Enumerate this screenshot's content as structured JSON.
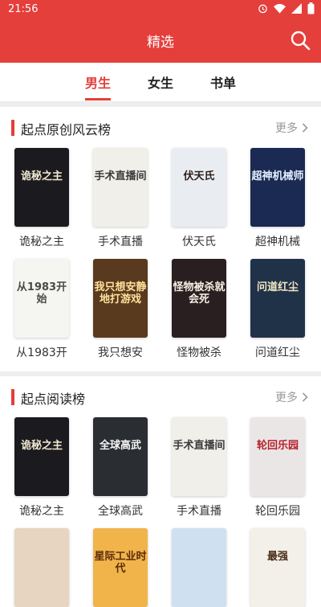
{
  "status": {
    "time": "21:56"
  },
  "header": {
    "title": "精选"
  },
  "tabs": [
    "男生",
    "女生",
    "书单"
  ],
  "sections": [
    {
      "title": "起点原创风云榜",
      "more": "更多",
      "books": [
        {
          "title": "诡秘之主",
          "cover_text": "诡秘之主",
          "bg": "#1b1b1f",
          "fg": "#f0e6cf"
        },
        {
          "title": "手术直播",
          "cover_text": "手术直播间",
          "bg": "#f1efe9",
          "fg": "#3b3b3b"
        },
        {
          "title": "伏天氏",
          "cover_text": "伏天氏",
          "bg": "#e9edf1",
          "fg": "#2b1d1a"
        },
        {
          "title": "超神机械",
          "cover_text": "超神机械师",
          "bg": "#1a2a52",
          "fg": "#e6f0ff"
        },
        {
          "title": "从1983开",
          "cover_text": "从1983开始",
          "bg": "#f5f5f2",
          "fg": "#4a4a4a"
        },
        {
          "title": "我只想安",
          "cover_text": "我只想安静地打游戏",
          "bg": "#5a3a1e",
          "fg": "#ffe29a"
        },
        {
          "title": "怪物被杀",
          "cover_text": "怪物被杀就会死",
          "bg": "#2a1f20",
          "fg": "#f6efe2"
        },
        {
          "title": "问道红尘",
          "cover_text": "问道红尘",
          "bg": "#203248",
          "fg": "#f3e6c4"
        }
      ]
    },
    {
      "title": "起点阅读榜",
      "more": "更多",
      "books": [
        {
          "title": "诡秘之主",
          "cover_text": "诡秘之主",
          "bg": "#1b1b1f",
          "fg": "#f0e6cf"
        },
        {
          "title": "全球高武",
          "cover_text": "全球高武",
          "bg": "#2a2d32",
          "fg": "#f6f6f6"
        },
        {
          "title": "手术直播",
          "cover_text": "手术直播间",
          "bg": "#f1efe9",
          "fg": "#3b3b3b"
        },
        {
          "title": "轮回乐园",
          "cover_text": "轮回乐园",
          "bg": "#ebe6e6",
          "fg": "#b6202a"
        },
        {
          "title": "",
          "cover_text": "",
          "bg": "#e7d4c1",
          "fg": "#333"
        },
        {
          "title": "",
          "cover_text": "星际工业时代",
          "bg": "#f0b44b",
          "fg": "#5b2b0a"
        },
        {
          "title": "",
          "cover_text": "",
          "bg": "#cfe1f0",
          "fg": "#333"
        },
        {
          "title": "",
          "cover_text": "最强",
          "bg": "#f3efe9",
          "fg": "#4b2e1a"
        }
      ]
    }
  ]
}
